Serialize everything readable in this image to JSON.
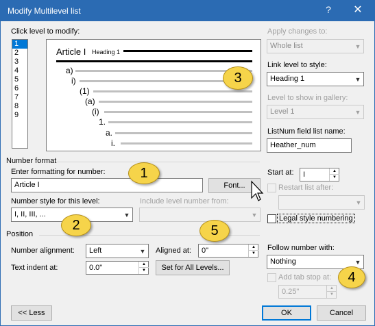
{
  "window": {
    "title": "Modify Multilevel list",
    "help": "?",
    "close": "✕"
  },
  "left": {
    "click_level_label": "Click level to modify:",
    "levels": [
      "1",
      "2",
      "3",
      "4",
      "5",
      "6",
      "7",
      "8",
      "9"
    ],
    "selected_level": "1"
  },
  "preview": {
    "article": "Article I",
    "heading": "Heading 1",
    "numbers": [
      "a)",
      "i)",
      "(1)",
      "(a)",
      "(i)",
      "1.",
      "a.",
      "i."
    ]
  },
  "right": {
    "apply_label": "Apply changes to:",
    "apply_value": "Whole list",
    "link_label": "Link level to style:",
    "link_value": "Heading 1",
    "gallery_label": "Level to show in gallery:",
    "gallery_value": "Level 1",
    "listnum_label": "ListNum field list name:",
    "listnum_value": "Heather_num"
  },
  "number_format": {
    "section_label": "Number format",
    "enter_label": "Enter formatting for number:",
    "enter_value": "Article I",
    "font_button": "Font...",
    "style_label": "Number style for this level:",
    "style_value": "I, II, III, ...",
    "include_label": "Include level number from:",
    "start_label": "Start at:",
    "start_value": "I",
    "restart_label": "Restart list after:",
    "legal_label": "Legal style numbering"
  },
  "position": {
    "section_label": "Position",
    "alignment_label": "Number alignment:",
    "alignment_value": "Left",
    "aligned_at_label": "Aligned at:",
    "aligned_at_value": "0\"",
    "indent_label": "Text indent at:",
    "indent_value": "0.0\"",
    "set_all_button": "Set for All Levels...",
    "follow_label": "Follow number with:",
    "follow_value": "Nothing",
    "tab_stop_label": "Add tab stop at:",
    "tab_stop_value": "0.25\""
  },
  "footer": {
    "less_button": "<< Less",
    "ok_button": "OK",
    "cancel_button": "Cancel"
  },
  "callouts": [
    "1",
    "2",
    "3",
    "4",
    "5"
  ],
  "colors": {
    "accent": "#2b6bb3",
    "callout": "#f6d44a",
    "selection": "#0078d7"
  }
}
